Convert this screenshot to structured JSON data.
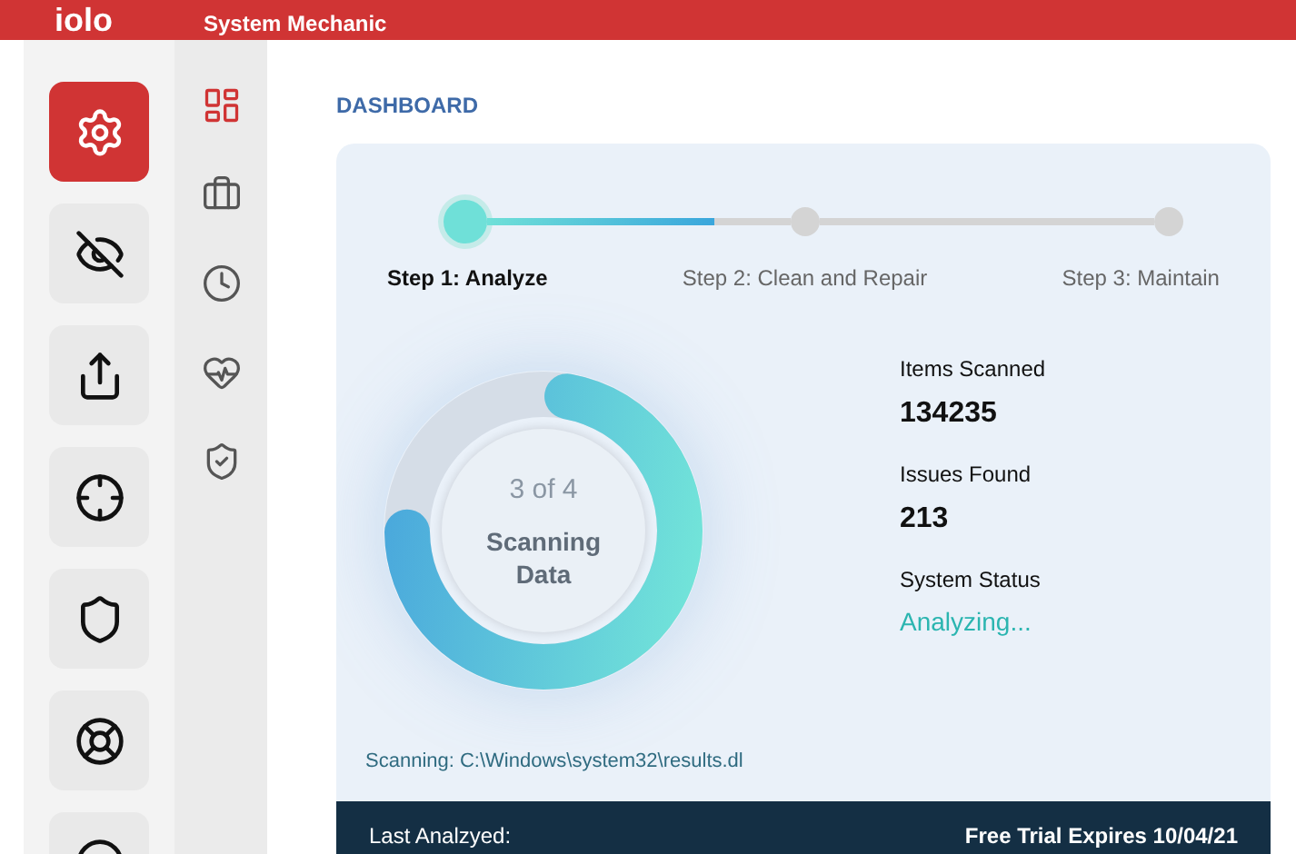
{
  "header": {
    "logo": "iolo",
    "title": "System Mechanic"
  },
  "tools": [
    {
      "selected": true
    },
    {
      "selected": false
    },
    {
      "selected": false
    },
    {
      "selected": false
    },
    {
      "selected": false
    },
    {
      "selected": false
    },
    {
      "selected": false
    }
  ],
  "nav": [
    {
      "selected": true
    },
    {
      "selected": false
    },
    {
      "selected": false
    },
    {
      "selected": false
    },
    {
      "selected": false
    }
  ],
  "page_title": "DASHBOARD",
  "steps": [
    {
      "label": "Step 1: Analyze",
      "selected": true
    },
    {
      "label": "Step 2: Clean and Repair",
      "selected": false
    },
    {
      "label": "Step 3: Maintain",
      "selected": false
    }
  ],
  "connectors": [
    {
      "level": 0.75
    },
    {
      "level": 0
    }
  ],
  "scan": {
    "progress_text": "3 of 4",
    "label": "Scanning Data",
    "level": 0.72
  },
  "stats": [
    {
      "label": "Items Scanned",
      "value": "134235",
      "kind": "number"
    },
    {
      "label": "Issues Found",
      "value": "213",
      "kind": "number"
    },
    {
      "label": "System Status",
      "value": "Analyzing...",
      "kind": "status"
    }
  ],
  "scanning_path": "Scanning: C:\\Windows\\system32\\results.dl",
  "footer": {
    "last_analyzed": "Last Analzyed:",
    "trial": "Free Trial Expires 10/04/21"
  }
}
